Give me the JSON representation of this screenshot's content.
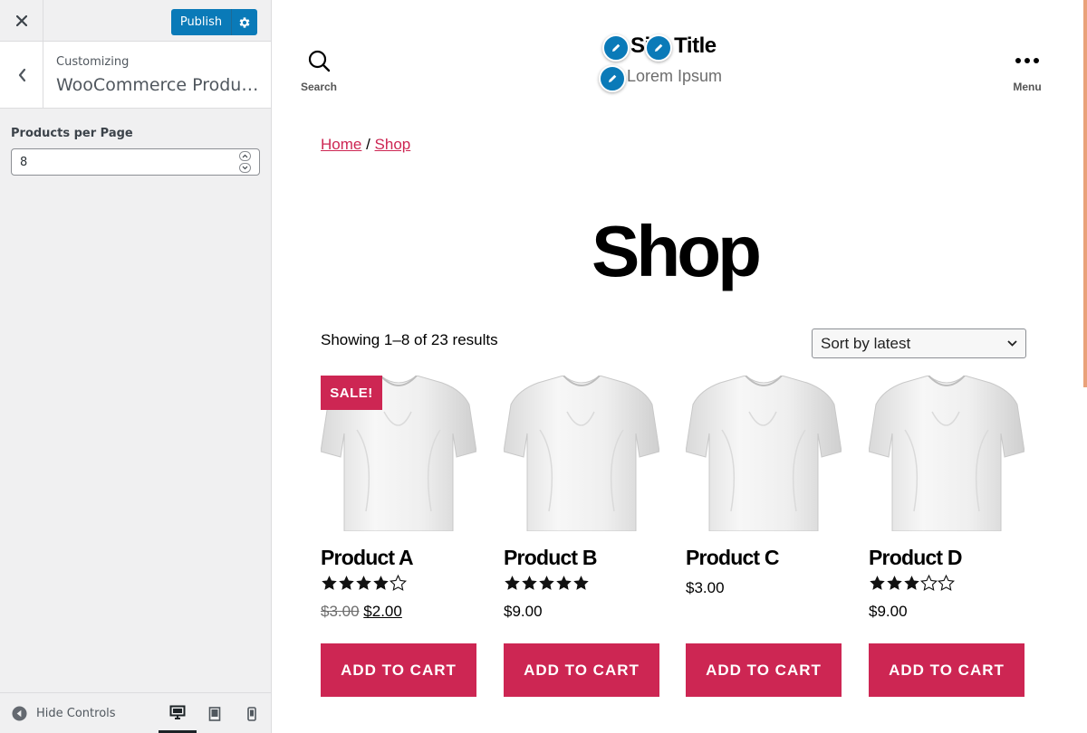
{
  "customizer": {
    "publish_label": "Publish",
    "customizing_label": "Customizing",
    "section_title": "WooCommerce Product Catalog",
    "control_label": "Products per Page",
    "products_per_page": "8",
    "hide_controls_label": "Hide Controls"
  },
  "header": {
    "search_label": "Search",
    "menu_label": "Menu",
    "site_title": "Site Title",
    "site_description": "Lorem Ipsum"
  },
  "breadcrumb": {
    "home": "Home",
    "separator": " / ",
    "shop": "Shop"
  },
  "page": {
    "title": "Shop",
    "result_count": "Showing 1–8 of 23 results",
    "orderby_selected": "Sort by latest"
  },
  "products": [
    {
      "name": "Product A",
      "rating": 4,
      "on_sale": true,
      "sale_badge": "SALE!",
      "regular_price": "$3.00",
      "price": "$2.00",
      "button": "ADD TO CART"
    },
    {
      "name": "Product B",
      "rating": 5,
      "on_sale": false,
      "price": "$9.00",
      "button": "ADD TO CART"
    },
    {
      "name": "Product C",
      "rating": 0,
      "on_sale": false,
      "price": "$3.00",
      "button": "ADD TO CART"
    },
    {
      "name": "Product D",
      "rating": 3,
      "on_sale": false,
      "price": "$9.00",
      "button": "ADD TO CART"
    }
  ],
  "colors": {
    "accent": "#cd2653",
    "wp_blue": "#0a7ab8",
    "sidebar_bg": "#f0f0f1"
  },
  "icons": [
    "close-icon",
    "gear-icon",
    "chevron-left-icon",
    "search-icon",
    "menu-dots-icon",
    "pencil-icon",
    "star-icon",
    "chevron-down-icon",
    "collapse-icon",
    "desktop-icon",
    "tablet-icon",
    "mobile-icon"
  ]
}
